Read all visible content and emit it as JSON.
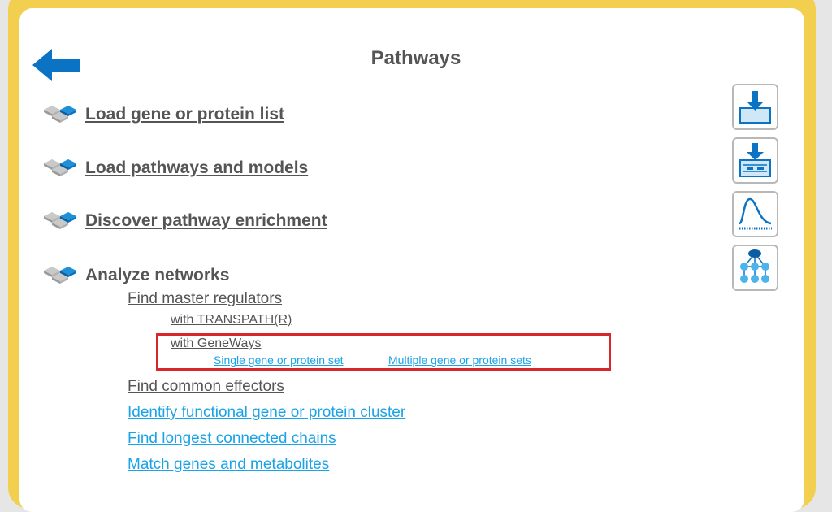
{
  "header": {
    "title": "Pathways",
    "back_icon": "back-arrow-icon"
  },
  "sections": [
    {
      "label": "Load gene or protein list",
      "link": true
    },
    {
      "label": "Load pathways and models",
      "link": true
    },
    {
      "label": "Discover pathway enrichment",
      "link": true
    },
    {
      "label": "Analyze networks",
      "link": false
    }
  ],
  "analyze_networks": {
    "find_master_regulators": {
      "label": "Find master regulators",
      "with_transpath": "with TRANSPATH(R)",
      "with_geneways": {
        "label": "with GeneWays",
        "single": "Single gene or protein set",
        "multiple": "Multiple gene or protein sets"
      }
    },
    "find_common_effectors": "Find common effectors",
    "identify_cluster": "Identify functional gene or protein cluster",
    "longest_chains": "Find longest connected chains",
    "match_genes": "Match genes and metabolites"
  },
  "toolbar": {
    "icons": [
      "import-data-icon",
      "import-table-icon",
      "distribution-curve-icon",
      "network-tree-icon"
    ]
  },
  "colors": {
    "frame": "#f2cf4f",
    "accent_blue": "#0a73c4",
    "link_blue": "#1aa3e6",
    "text_gray": "#555555",
    "highlight_red": "#d9262b"
  }
}
